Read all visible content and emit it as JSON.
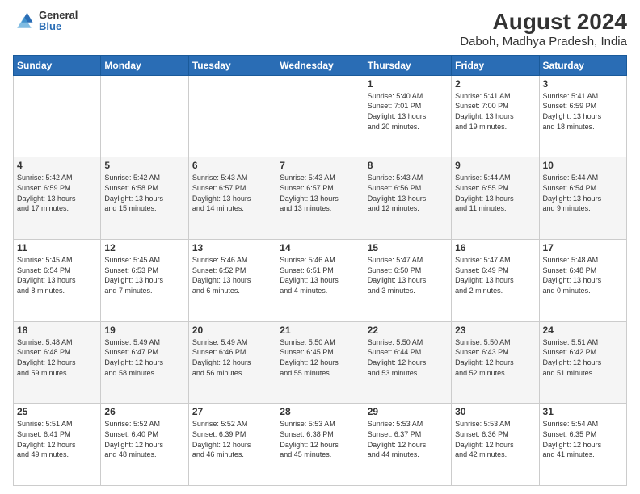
{
  "logo": {
    "general": "General",
    "blue": "Blue"
  },
  "title": "August 2024",
  "subtitle": "Daboh, Madhya Pradesh, India",
  "days_of_week": [
    "Sunday",
    "Monday",
    "Tuesday",
    "Wednesday",
    "Thursday",
    "Friday",
    "Saturday"
  ],
  "weeks": [
    [
      {
        "day": "",
        "info": ""
      },
      {
        "day": "",
        "info": ""
      },
      {
        "day": "",
        "info": ""
      },
      {
        "day": "",
        "info": ""
      },
      {
        "day": "1",
        "info": "Sunrise: 5:40 AM\nSunset: 7:01 PM\nDaylight: 13 hours\nand 20 minutes."
      },
      {
        "day": "2",
        "info": "Sunrise: 5:41 AM\nSunset: 7:00 PM\nDaylight: 13 hours\nand 19 minutes."
      },
      {
        "day": "3",
        "info": "Sunrise: 5:41 AM\nSunset: 6:59 PM\nDaylight: 13 hours\nand 18 minutes."
      }
    ],
    [
      {
        "day": "4",
        "info": "Sunrise: 5:42 AM\nSunset: 6:59 PM\nDaylight: 13 hours\nand 17 minutes."
      },
      {
        "day": "5",
        "info": "Sunrise: 5:42 AM\nSunset: 6:58 PM\nDaylight: 13 hours\nand 15 minutes."
      },
      {
        "day": "6",
        "info": "Sunrise: 5:43 AM\nSunset: 6:57 PM\nDaylight: 13 hours\nand 14 minutes."
      },
      {
        "day": "7",
        "info": "Sunrise: 5:43 AM\nSunset: 6:57 PM\nDaylight: 13 hours\nand 13 minutes."
      },
      {
        "day": "8",
        "info": "Sunrise: 5:43 AM\nSunset: 6:56 PM\nDaylight: 13 hours\nand 12 minutes."
      },
      {
        "day": "9",
        "info": "Sunrise: 5:44 AM\nSunset: 6:55 PM\nDaylight: 13 hours\nand 11 minutes."
      },
      {
        "day": "10",
        "info": "Sunrise: 5:44 AM\nSunset: 6:54 PM\nDaylight: 13 hours\nand 9 minutes."
      }
    ],
    [
      {
        "day": "11",
        "info": "Sunrise: 5:45 AM\nSunset: 6:54 PM\nDaylight: 13 hours\nand 8 minutes."
      },
      {
        "day": "12",
        "info": "Sunrise: 5:45 AM\nSunset: 6:53 PM\nDaylight: 13 hours\nand 7 minutes."
      },
      {
        "day": "13",
        "info": "Sunrise: 5:46 AM\nSunset: 6:52 PM\nDaylight: 13 hours\nand 6 minutes."
      },
      {
        "day": "14",
        "info": "Sunrise: 5:46 AM\nSunset: 6:51 PM\nDaylight: 13 hours\nand 4 minutes."
      },
      {
        "day": "15",
        "info": "Sunrise: 5:47 AM\nSunset: 6:50 PM\nDaylight: 13 hours\nand 3 minutes."
      },
      {
        "day": "16",
        "info": "Sunrise: 5:47 AM\nSunset: 6:49 PM\nDaylight: 13 hours\nand 2 minutes."
      },
      {
        "day": "17",
        "info": "Sunrise: 5:48 AM\nSunset: 6:48 PM\nDaylight: 13 hours\nand 0 minutes."
      }
    ],
    [
      {
        "day": "18",
        "info": "Sunrise: 5:48 AM\nSunset: 6:48 PM\nDaylight: 12 hours\nand 59 minutes."
      },
      {
        "day": "19",
        "info": "Sunrise: 5:49 AM\nSunset: 6:47 PM\nDaylight: 12 hours\nand 58 minutes."
      },
      {
        "day": "20",
        "info": "Sunrise: 5:49 AM\nSunset: 6:46 PM\nDaylight: 12 hours\nand 56 minutes."
      },
      {
        "day": "21",
        "info": "Sunrise: 5:50 AM\nSunset: 6:45 PM\nDaylight: 12 hours\nand 55 minutes."
      },
      {
        "day": "22",
        "info": "Sunrise: 5:50 AM\nSunset: 6:44 PM\nDaylight: 12 hours\nand 53 minutes."
      },
      {
        "day": "23",
        "info": "Sunrise: 5:50 AM\nSunset: 6:43 PM\nDaylight: 12 hours\nand 52 minutes."
      },
      {
        "day": "24",
        "info": "Sunrise: 5:51 AM\nSunset: 6:42 PM\nDaylight: 12 hours\nand 51 minutes."
      }
    ],
    [
      {
        "day": "25",
        "info": "Sunrise: 5:51 AM\nSunset: 6:41 PM\nDaylight: 12 hours\nand 49 minutes."
      },
      {
        "day": "26",
        "info": "Sunrise: 5:52 AM\nSunset: 6:40 PM\nDaylight: 12 hours\nand 48 minutes."
      },
      {
        "day": "27",
        "info": "Sunrise: 5:52 AM\nSunset: 6:39 PM\nDaylight: 12 hours\nand 46 minutes."
      },
      {
        "day": "28",
        "info": "Sunrise: 5:53 AM\nSunset: 6:38 PM\nDaylight: 12 hours\nand 45 minutes."
      },
      {
        "day": "29",
        "info": "Sunrise: 5:53 AM\nSunset: 6:37 PM\nDaylight: 12 hours\nand 44 minutes."
      },
      {
        "day": "30",
        "info": "Sunrise: 5:53 AM\nSunset: 6:36 PM\nDaylight: 12 hours\nand 42 minutes."
      },
      {
        "day": "31",
        "info": "Sunrise: 5:54 AM\nSunset: 6:35 PM\nDaylight: 12 hours\nand 41 minutes."
      }
    ]
  ]
}
